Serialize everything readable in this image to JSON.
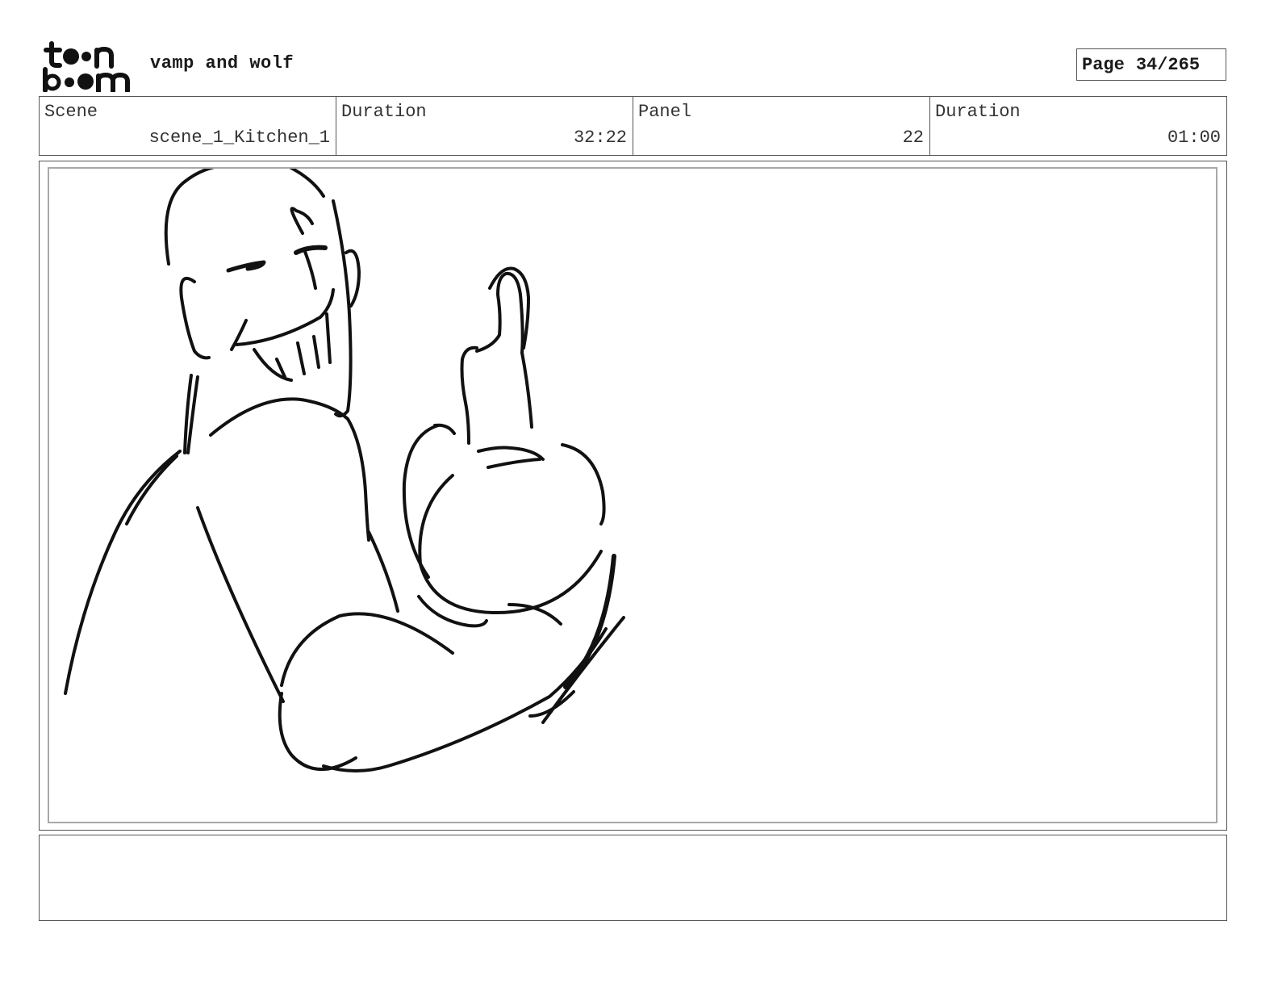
{
  "header": {
    "logo_text": "toon boom",
    "project_title": "vamp and wolf",
    "page_label": "Page",
    "page_number": "34/265"
  },
  "info": {
    "scene_label": "Scene",
    "scene_value": "scene_1_Kitchen_1",
    "scene_duration_label": "Duration",
    "scene_duration_value": "32:22",
    "panel_label": "Panel",
    "panel_value": "22",
    "panel_duration_label": "Duration",
    "panel_duration_value": "01:00"
  },
  "panel": {
    "drawing": "sketch-figure-holding-bottle-icon"
  },
  "notes": {
    "text": ""
  }
}
